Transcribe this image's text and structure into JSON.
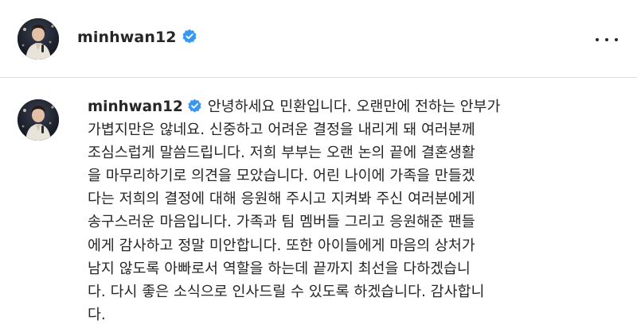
{
  "post": {
    "username": "minhwan12",
    "verified": true,
    "more_icon": "more-horizontal-icon"
  },
  "caption": {
    "username": "minhwan12",
    "lines": [
      "안녕하세요 민환입니다. 오랜만에 전하는 안부가",
      "가볍지만은 않네요. 신중하고 어려운 결정을 내리게 돼 여러분께",
      "조심스럽게 말씀드립니다. 저희 부부는 오랜 논의 끝에 결혼생활",
      "을 마무리하기로 의견을 모았습니다. 어린 나이에 가족을 만들겠",
      "다는 저희의 결정에 대해 응원해 주시고 지켜봐 주신 여러분에게",
      "송구스러운 마음입니다. 가족과 팀 멤버들 그리고 응원해준 팬들",
      "에게 감사하고 정말 미안합니다. 또한 아이들에게 마음의 상처가",
      "남지 않도록 아빠로서 역할을 하는데 끝까지 최선을 다하겠습니",
      "다. 다시 좋은 소식으로 인사드릴 수 있도록 하겠습니다. 감사합니",
      "다."
    ]
  },
  "colors": {
    "text": "#262626",
    "verified_badge": "#3897f0",
    "divider": "#dbdbdb",
    "background": "#ffffff"
  }
}
